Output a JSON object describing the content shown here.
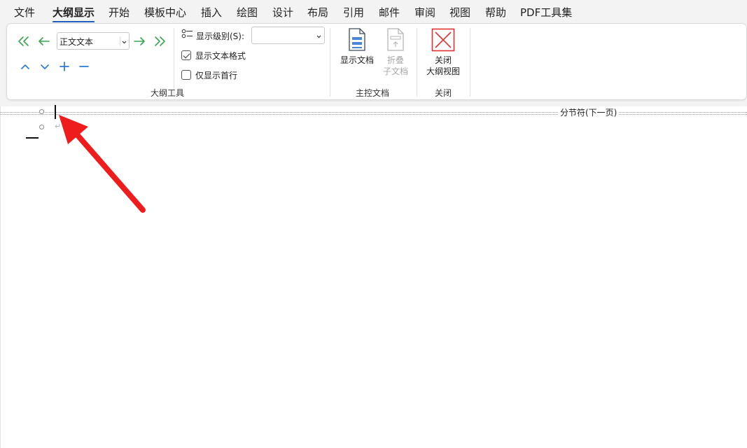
{
  "menu": {
    "tabs": [
      {
        "label": "文件"
      },
      {
        "label": "大纲显示"
      },
      {
        "label": "开始"
      },
      {
        "label": "模板中心"
      },
      {
        "label": "插入"
      },
      {
        "label": "绘图"
      },
      {
        "label": "设计"
      },
      {
        "label": "布局"
      },
      {
        "label": "引用"
      },
      {
        "label": "邮件"
      },
      {
        "label": "审阅"
      },
      {
        "label": "视图"
      },
      {
        "label": "帮助"
      },
      {
        "label": "PDF工具集"
      }
    ],
    "active_tab": "大纲显示"
  },
  "outline_tools": {
    "group_label": "大纲工具",
    "style_value": "正文文本",
    "show_level_label": "显示级别(S):",
    "show_level_value": "",
    "show_text_format_label": "显示文本格式",
    "show_text_format_checked": true,
    "show_first_line_label": "仅显示首行",
    "show_first_line_checked": false
  },
  "master_document": {
    "group_label": "主控文档",
    "show_document_label": "显示文档",
    "collapse_line1": "折叠",
    "collapse_line2": "子文档"
  },
  "close_group": {
    "group_label": "关闭",
    "close_line1": "关闭",
    "close_line2": "大纲视图"
  },
  "document": {
    "section_break_label": "分节符(下一页)"
  },
  "colors": {
    "accent": "#1f5fbf",
    "arrow_green": "#3aa655",
    "nav_blue": "#2b7bd6",
    "close_red": "#e03131",
    "annotation_red": "#ee1c1c"
  }
}
